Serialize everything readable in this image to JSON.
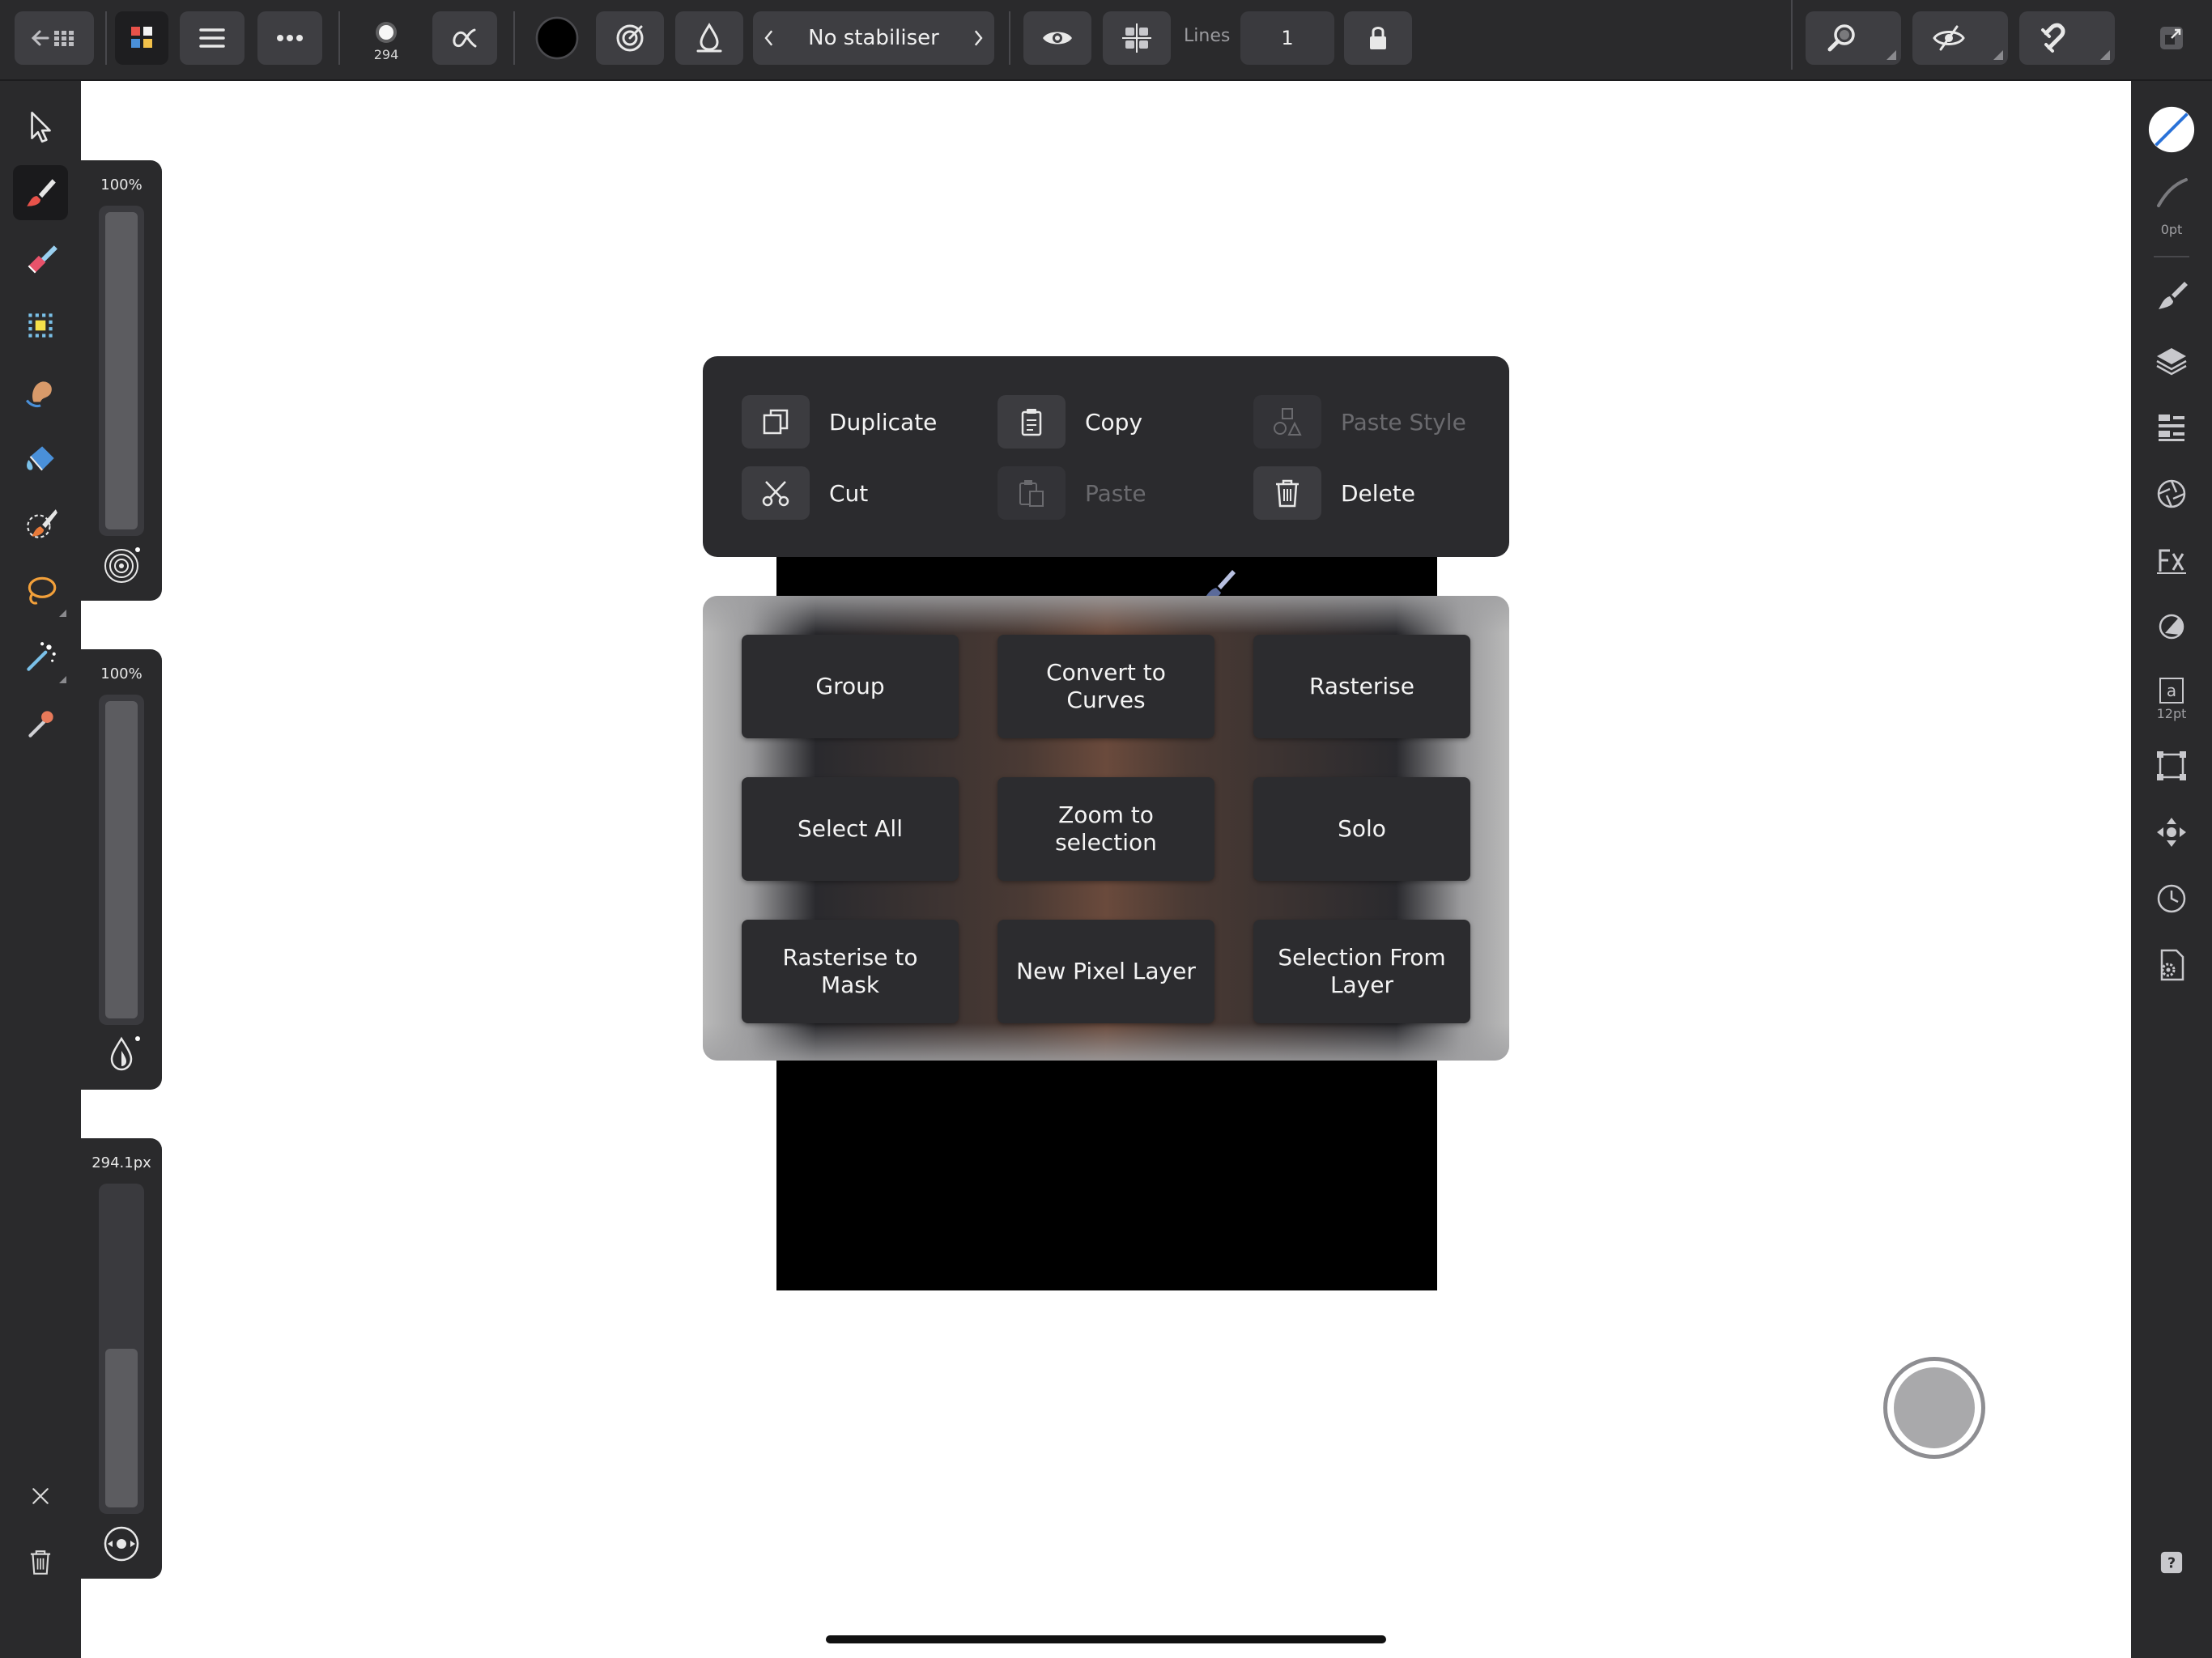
{
  "toolbar": {
    "brush_size_badge": "294",
    "stabiliser": "No stabiliser",
    "lines_label": "Lines",
    "lines_value": "1"
  },
  "sliders": {
    "opacity": {
      "label": "100%",
      "level": 1.0
    },
    "flow": {
      "label": "100%",
      "level": 1.0
    },
    "width": {
      "label": "294.1px",
      "level": 0.5
    }
  },
  "right_panel": {
    "stroke_width": "0pt",
    "text_size": "12pt"
  },
  "context_menu": {
    "duplicate": "Duplicate",
    "copy": "Copy",
    "paste_style": "Paste Style",
    "cut": "Cut",
    "paste": "Paste",
    "delete": "Delete"
  },
  "commands": [
    "Group",
    "Convert to Curves",
    "Rasterise",
    "Select All",
    "Zoom to selection",
    "Solo",
    "Rasterise to Mask",
    "New Pixel Layer",
    "Selection From Layer"
  ],
  "colors": {
    "primary_colour": "#000000",
    "toolbar_bg": "#2a2a2c",
    "button_bg": "#3e3e42"
  }
}
